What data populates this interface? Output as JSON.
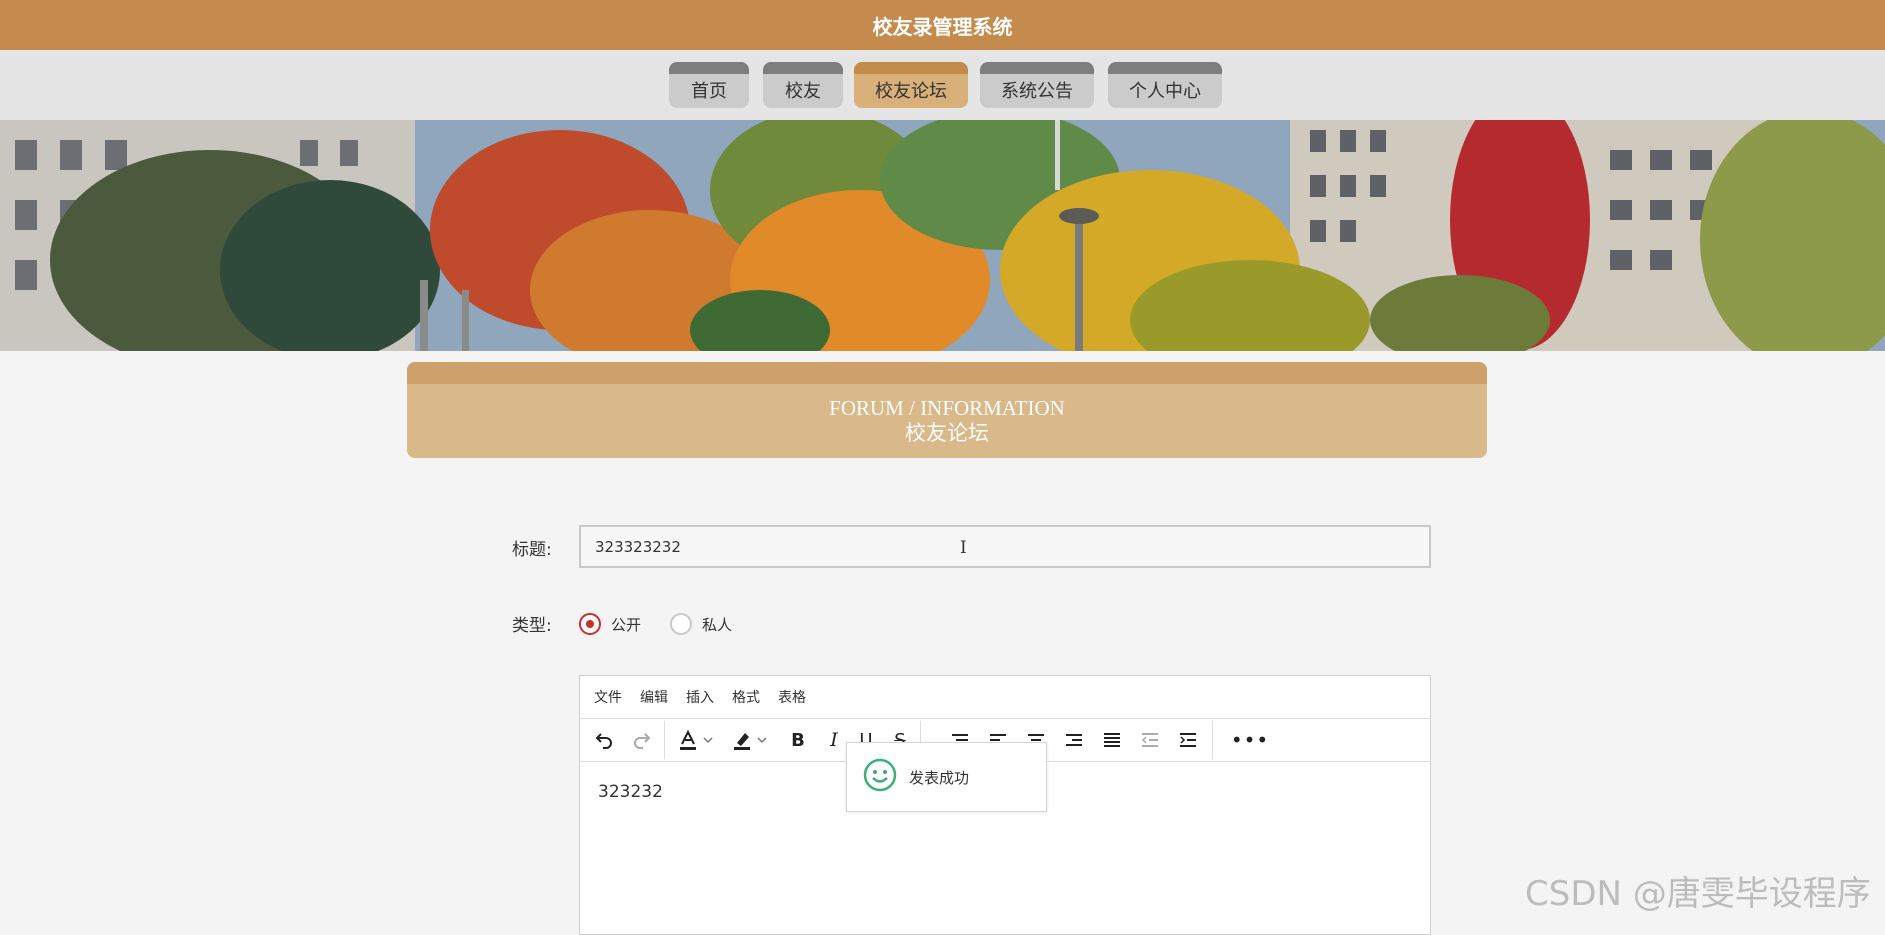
{
  "app": {
    "title": "校友录管理系统"
  },
  "nav": {
    "items": [
      {
        "label": "首页"
      },
      {
        "label": "校友"
      },
      {
        "label": "校友论坛"
      },
      {
        "label": "系统公告"
      },
      {
        "label": "个人中心"
      }
    ],
    "active": "校友论坛"
  },
  "section": {
    "title_en": "FORUM / INFORMATION",
    "title_cn": "校友论坛"
  },
  "form": {
    "title_label": "标题:",
    "title_value": "323323232",
    "type_label": "类型:",
    "type_options": [
      "公开",
      "私人"
    ],
    "type_selected": "公开"
  },
  "editor": {
    "menus": [
      "文件",
      "编辑",
      "插入",
      "格式",
      "表格"
    ],
    "toolbar": [
      "undo-icon",
      "redo-icon",
      "font-color-icon",
      "highlight-icon",
      "bold-icon",
      "italic-icon",
      "underline-icon",
      "strikethrough-icon",
      "list-icon",
      "align-left-icon",
      "align-center-icon",
      "align-right-icon",
      "justify-icon",
      "outdent-icon",
      "indent-icon",
      "more-icon"
    ],
    "content": "323232"
  },
  "toast": {
    "message": "发表成功",
    "icon": "smiley-icon"
  },
  "watermark": "CSDN @唐雯毕设程序",
  "colors": {
    "header": "#c58b4c",
    "nav_active": "#d9b07a",
    "section_title": "#d9b889",
    "radio_checked": "#c8302c",
    "toast_icon": "#3cae7a"
  }
}
